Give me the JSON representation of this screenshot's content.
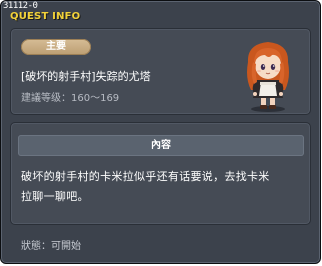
{
  "window": {
    "quest_id": "31112-0",
    "title": "QUEST INFO"
  },
  "summary": {
    "badge_label": "主要",
    "quest_name": "[破坏的射手村]失踪的尤塔",
    "recommend_level": "建議等级：160～169",
    "npc_icon": "npc-portrait-icon"
  },
  "content": {
    "header": "內容",
    "description_line1": "破坏的射手村的卡米拉似乎还有话要说，去找卡米",
    "description_line2": "拉聊一聊吧。"
  },
  "status": {
    "text": "狀態：可開始"
  },
  "colors": {
    "window_bg": "#3c424c",
    "panel_bg": "#454b55",
    "title_yellow": "#f2d23a",
    "badge_tan": "#c9ad84"
  }
}
